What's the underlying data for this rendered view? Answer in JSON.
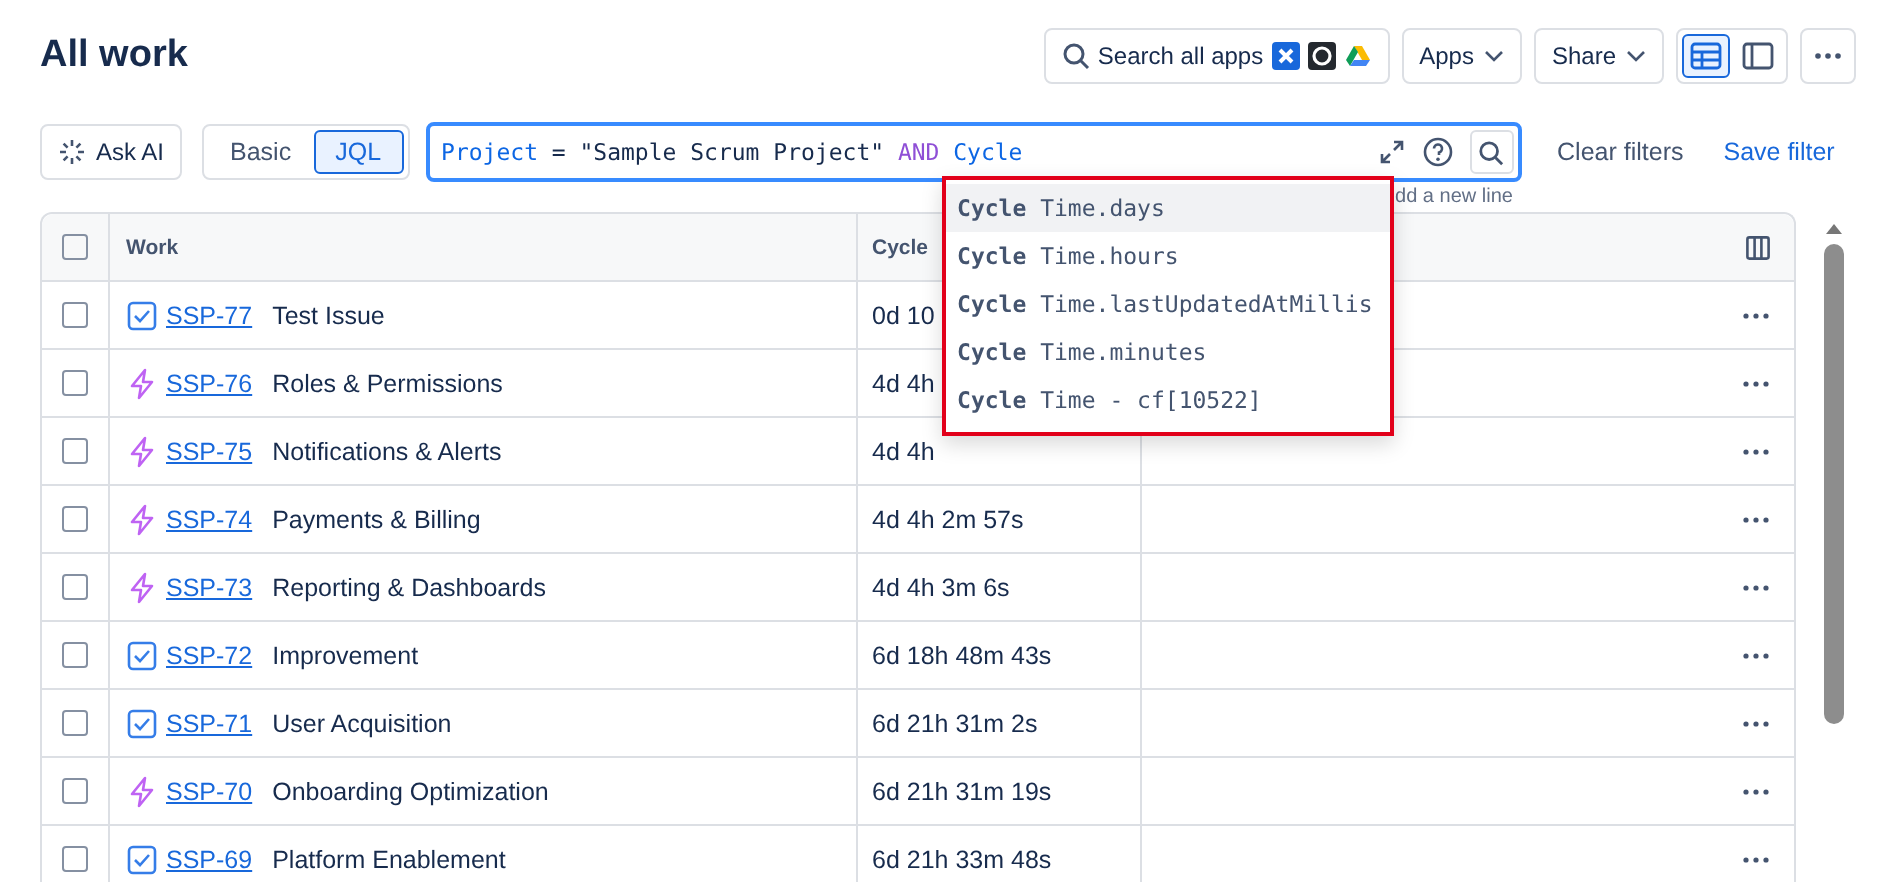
{
  "title": "All work",
  "header_actions": {
    "search_apps": "Search all apps",
    "apps": "Apps",
    "share": "Share",
    "views": [
      {
        "kind": "list",
        "selected": true
      },
      {
        "kind": "detail",
        "selected": false
      }
    ]
  },
  "filter_bar": {
    "ask_ai": "Ask AI",
    "modes": [
      {
        "label": "Basic",
        "selected": false
      },
      {
        "label": "JQL",
        "selected": true
      }
    ],
    "query": [
      {
        "kind": "field",
        "text": "Project"
      },
      {
        "kind": "op",
        "text": "="
      },
      {
        "kind": "string",
        "text": "\"Sample Scrum Project\""
      },
      {
        "kind": "keyword",
        "text": "AND"
      },
      {
        "kind": "field",
        "text": "Cycle"
      }
    ],
    "hint": "dd a new line",
    "clear": "Clear filters",
    "save": "Save filter"
  },
  "suggestions": [
    {
      "text": "**Cycle** Time.days",
      "selected": true
    },
    {
      "text": "**Cycle** Time.hours",
      "selected": false
    },
    {
      "text": "**Cycle** Time.lastUpdatedAtMillis",
      "selected": false
    },
    {
      "text": "**Cycle** Time.minutes",
      "selected": false
    },
    {
      "text": "**Cycle** Time - cf[10522]",
      "selected": false
    }
  ],
  "table": {
    "select_all": false,
    "columns": [
      "Work",
      "Cycle"
    ],
    "rows": [
      {
        "kind": "task",
        "key": "SSP-77",
        "summary": "Test Issue",
        "cycle": "0d 10",
        "checked": false
      },
      {
        "kind": "epic",
        "key": "SSP-76",
        "summary": "Roles & Permissions",
        "cycle": "4d 4h",
        "checked": false
      },
      {
        "kind": "epic",
        "key": "SSP-75",
        "summary": "Notifications & Alerts",
        "cycle": "4d 4h",
        "checked": false
      },
      {
        "kind": "epic",
        "key": "SSP-74",
        "summary": "Payments & Billing",
        "cycle": "4d 4h 2m 57s",
        "checked": false
      },
      {
        "kind": "epic",
        "key": "SSP-73",
        "summary": "Reporting & Dashboards",
        "cycle": "4d 4h 3m 6s",
        "checked": false
      },
      {
        "kind": "task",
        "key": "SSP-72",
        "summary": "Improvement",
        "cycle": "6d 18h 48m 43s",
        "checked": false
      },
      {
        "kind": "task",
        "key": "SSP-71",
        "summary": "User Acquisition",
        "cycle": "6d 21h 31m 2s",
        "checked": false
      },
      {
        "kind": "epic",
        "key": "SSP-70",
        "summary": "Onboarding Optimization",
        "cycle": "6d 21h 31m 19s",
        "checked": false
      },
      {
        "kind": "task",
        "key": "SSP-69",
        "summary": "Platform Enablement",
        "cycle": "6d 21h 33m 48s",
        "checked": false
      }
    ]
  }
}
